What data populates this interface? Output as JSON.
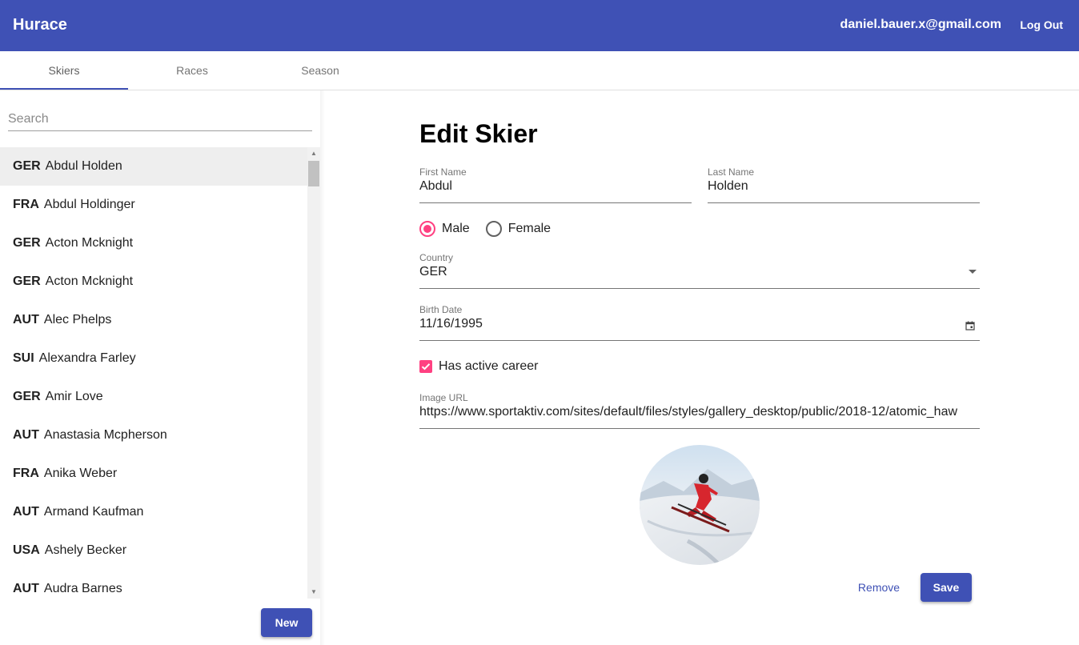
{
  "app": {
    "title": "Hurace",
    "user_email": "daniel.bauer.x@gmail.com",
    "logout_label": "Log Out"
  },
  "tabs": [
    {
      "label": "Skiers",
      "active": true
    },
    {
      "label": "Races",
      "active": false
    },
    {
      "label": "Season",
      "active": false
    }
  ],
  "sidebar": {
    "search_placeholder": "Search",
    "new_label": "New",
    "items": [
      {
        "country": "GER",
        "name": "Abdul Holden",
        "selected": true
      },
      {
        "country": "FRA",
        "name": "Abdul Holdinger"
      },
      {
        "country": "GER",
        "name": "Acton Mcknight"
      },
      {
        "country": "GER",
        "name": "Acton Mcknight"
      },
      {
        "country": "AUT",
        "name": "Alec Phelps"
      },
      {
        "country": "SUI",
        "name": "Alexandra Farley"
      },
      {
        "country": "GER",
        "name": "Amir Love"
      },
      {
        "country": "AUT",
        "name": "Anastasia Mcpherson"
      },
      {
        "country": "FRA",
        "name": "Anika Weber"
      },
      {
        "country": "AUT",
        "name": "Armand Kaufman"
      },
      {
        "country": "USA",
        "name": "Ashely Becker"
      },
      {
        "country": "AUT",
        "name": "Audra Barnes"
      }
    ]
  },
  "form": {
    "heading": "Edit Skier",
    "first_name_label": "First Name",
    "first_name": "Abdul",
    "last_name_label": "Last Name",
    "last_name": "Holden",
    "gender_male": "Male",
    "gender_female": "Female",
    "gender_selected": "Male",
    "country_label": "Country",
    "country": "GER",
    "birth_date_label": "Birth Date",
    "birth_date": "11/16/1995",
    "active_career_label": "Has active career",
    "active_career": true,
    "image_url_label": "Image URL",
    "image_url": "https://www.sportaktiv.com/sites/default/files/styles/gallery_desktop/public/2018-12/atomic_haw",
    "remove_label": "Remove",
    "save_label": "Save"
  },
  "colors": {
    "primary": "#3f51b5",
    "accent": "#ff4081"
  }
}
